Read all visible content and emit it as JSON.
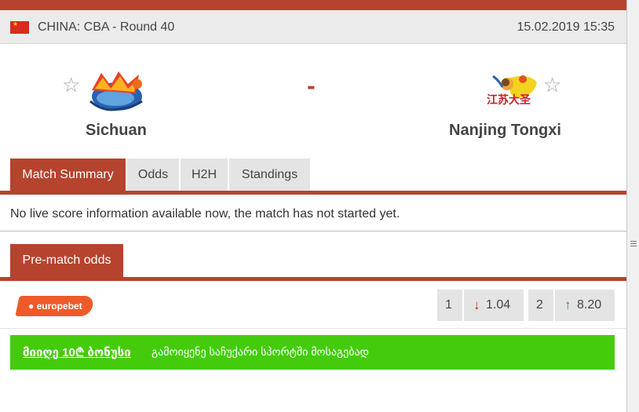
{
  "league": {
    "country_league": "CHINA: CBA - Round 40",
    "datetime": "15.02.2019 15:35",
    "flag_icon": "china-flag-icon"
  },
  "match": {
    "home": {
      "name": "Sichuan",
      "logo_icon": "sichuan-team-logo-icon"
    },
    "away": {
      "name": "Nanjing Tongxi",
      "logo_text": "江苏大圣",
      "logo_icon": "nanjing-team-logo-icon"
    },
    "score_separator": "-",
    "favorite_icon": "star-outline-icon"
  },
  "tabs": [
    {
      "label": "Match Summary",
      "active": true
    },
    {
      "label": "Odds",
      "active": false
    },
    {
      "label": "H2H",
      "active": false
    },
    {
      "label": "Standings",
      "active": false
    }
  ],
  "summary": {
    "info_text": "No live score information available now, the match has not started yet."
  },
  "prematch": {
    "tab_label": "Pre-match odds",
    "bookmaker": "europebet",
    "odds": [
      {
        "index": "1",
        "value": "1.04",
        "trend": "down",
        "trend_icon": "arrow-down-icon",
        "color": "#d0202a"
      },
      {
        "index": "2",
        "value": "8.20",
        "trend": "up",
        "trend_icon": "arrow-up-icon",
        "color": "#2a9a2a"
      }
    ]
  },
  "promo": {
    "link_text": "მიიღე 10₾ ბონუსი",
    "text": "გამოიყენე საჩუქარი სპორტში მოსაგებად"
  },
  "colors": {
    "accent": "#b5432e",
    "promo_green": "#44cc0c",
    "bookmaker_orange": "#ef5a2a"
  }
}
